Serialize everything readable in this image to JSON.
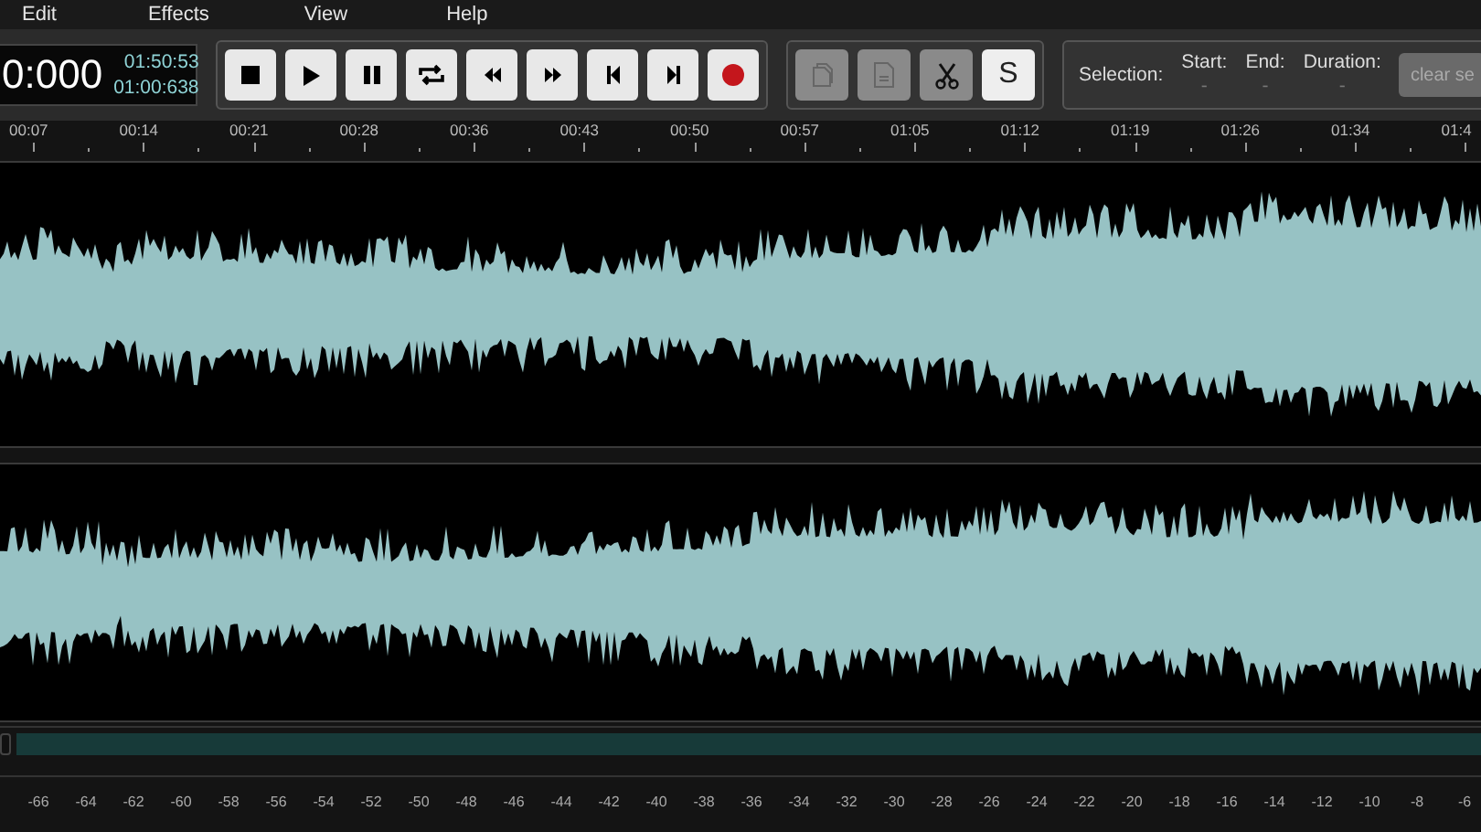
{
  "menu": [
    {
      "label": "Edit"
    },
    {
      "label": "Effects"
    },
    {
      "label": "View"
    },
    {
      "label": "Help"
    }
  ],
  "time_display": {
    "current": "0:000",
    "total": "01:50:53",
    "position": "01:00:638"
  },
  "transport_buttons": [
    {
      "kind": "stop"
    },
    {
      "kind": "play"
    },
    {
      "kind": "pause"
    },
    {
      "kind": "loop"
    },
    {
      "kind": "rewind"
    },
    {
      "kind": "forward"
    },
    {
      "kind": "skip-start"
    },
    {
      "kind": "skip-end"
    },
    {
      "kind": "record"
    }
  ],
  "edit_buttons": [
    {
      "kind": "copy",
      "disabled": true,
      "active": false
    },
    {
      "kind": "paste",
      "disabled": true,
      "active": false
    },
    {
      "kind": "cut",
      "disabled": false,
      "active": false
    },
    {
      "kind": "text",
      "label": "S",
      "disabled": false,
      "active": true
    }
  ],
  "selection": {
    "label": "Selection:",
    "fields": [
      {
        "label": "Start:",
        "value": "-"
      },
      {
        "label": "End:",
        "value": "-"
      },
      {
        "label": "Duration:",
        "value": "-"
      }
    ],
    "clear_button": "clear se"
  },
  "timeline": [
    "00:07",
    "00:14",
    "00:21",
    "00:28",
    "00:36",
    "00:43",
    "00:50",
    "00:57",
    "01:05",
    "01:12",
    "01:19",
    "01:26",
    "01:34",
    "01:4"
  ],
  "tracks": [
    {
      "kind": "waveform"
    },
    {
      "kind": "waveform"
    }
  ],
  "db_scale": [
    "-66",
    "-64",
    "-62",
    "-60",
    "-58",
    "-56",
    "-54",
    "-52",
    "-50",
    "-48",
    "-46",
    "-44",
    "-42",
    "-40",
    "-38",
    "-36",
    "-34",
    "-32",
    "-30",
    "-28",
    "-26",
    "-24",
    "-22",
    "-20",
    "-18",
    "-16",
    "-14",
    "-12",
    "-10",
    "-8",
    "-6"
  ]
}
